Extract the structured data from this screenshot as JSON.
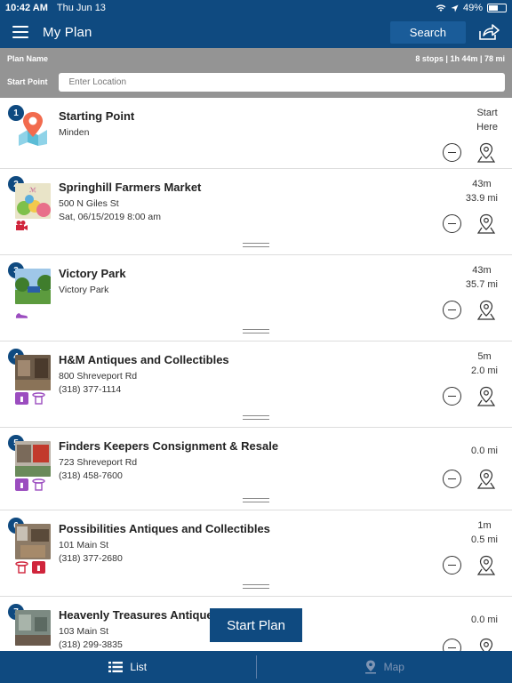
{
  "status": {
    "time": "10:42 AM",
    "date": "Thu Jun 13",
    "battery": "49%",
    "battery_fraction": 0.49
  },
  "header": {
    "title": "My Plan",
    "search_label": "Search",
    "icons": [
      "hamburger-menu-icon",
      "share-icon"
    ]
  },
  "plan": {
    "name_label": "Plan Name",
    "summary": "8 stops | 1h 44m | 78 mi",
    "start_label": "Start Point",
    "start_placeholder": "Enter Location"
  },
  "stops": [
    {
      "num": "1",
      "name": "Starting Point",
      "lines": [
        "Minden"
      ],
      "dist1": "Start",
      "dist2": "Here"
    },
    {
      "num": "2",
      "name": "Springhill Farmers Market",
      "lines": [
        "500 N Giles St",
        "Sat, 06/15/2019 8:00 am"
      ],
      "dist1": "43m",
      "dist2": "33.9 mi"
    },
    {
      "num": "3",
      "name": "Victory Park",
      "lines": [
        "Victory Park"
      ],
      "dist1": "43m",
      "dist2": "35.7 mi"
    },
    {
      "num": "4",
      "name": "H&M Antiques and Collectibles",
      "lines": [
        "800 Shreveport Rd",
        "(318) 377-1114"
      ],
      "dist1": "5m",
      "dist2": "2.0 mi"
    },
    {
      "num": "5",
      "name": "Finders Keepers Consignment & Resale",
      "lines": [
        "723 Shreveport Rd",
        "(318) 458-7600"
      ],
      "dist1": "0.0 mi",
      "dist2": ""
    },
    {
      "num": "6",
      "name": "Possibilities Antiques and Collectibles",
      "lines": [
        "101 Main St",
        "(318) 377-2680"
      ],
      "dist1": "1m",
      "dist2": "0.5 mi"
    },
    {
      "num": "7",
      "name": "Heavenly Treasures Antiques",
      "lines": [
        "103 Main St",
        "(318) 299-3835"
      ],
      "dist1": "0.0 mi",
      "dist2": ""
    }
  ],
  "start_plan_label": "Start Plan",
  "tabs": {
    "list_label": "List",
    "map_label": "Map"
  },
  "colors": {
    "brand_blue": "#0f4a80",
    "plan_bar_gray": "#949494",
    "category_red": "#d0253c",
    "category_purple": "#9b4dbf"
  }
}
